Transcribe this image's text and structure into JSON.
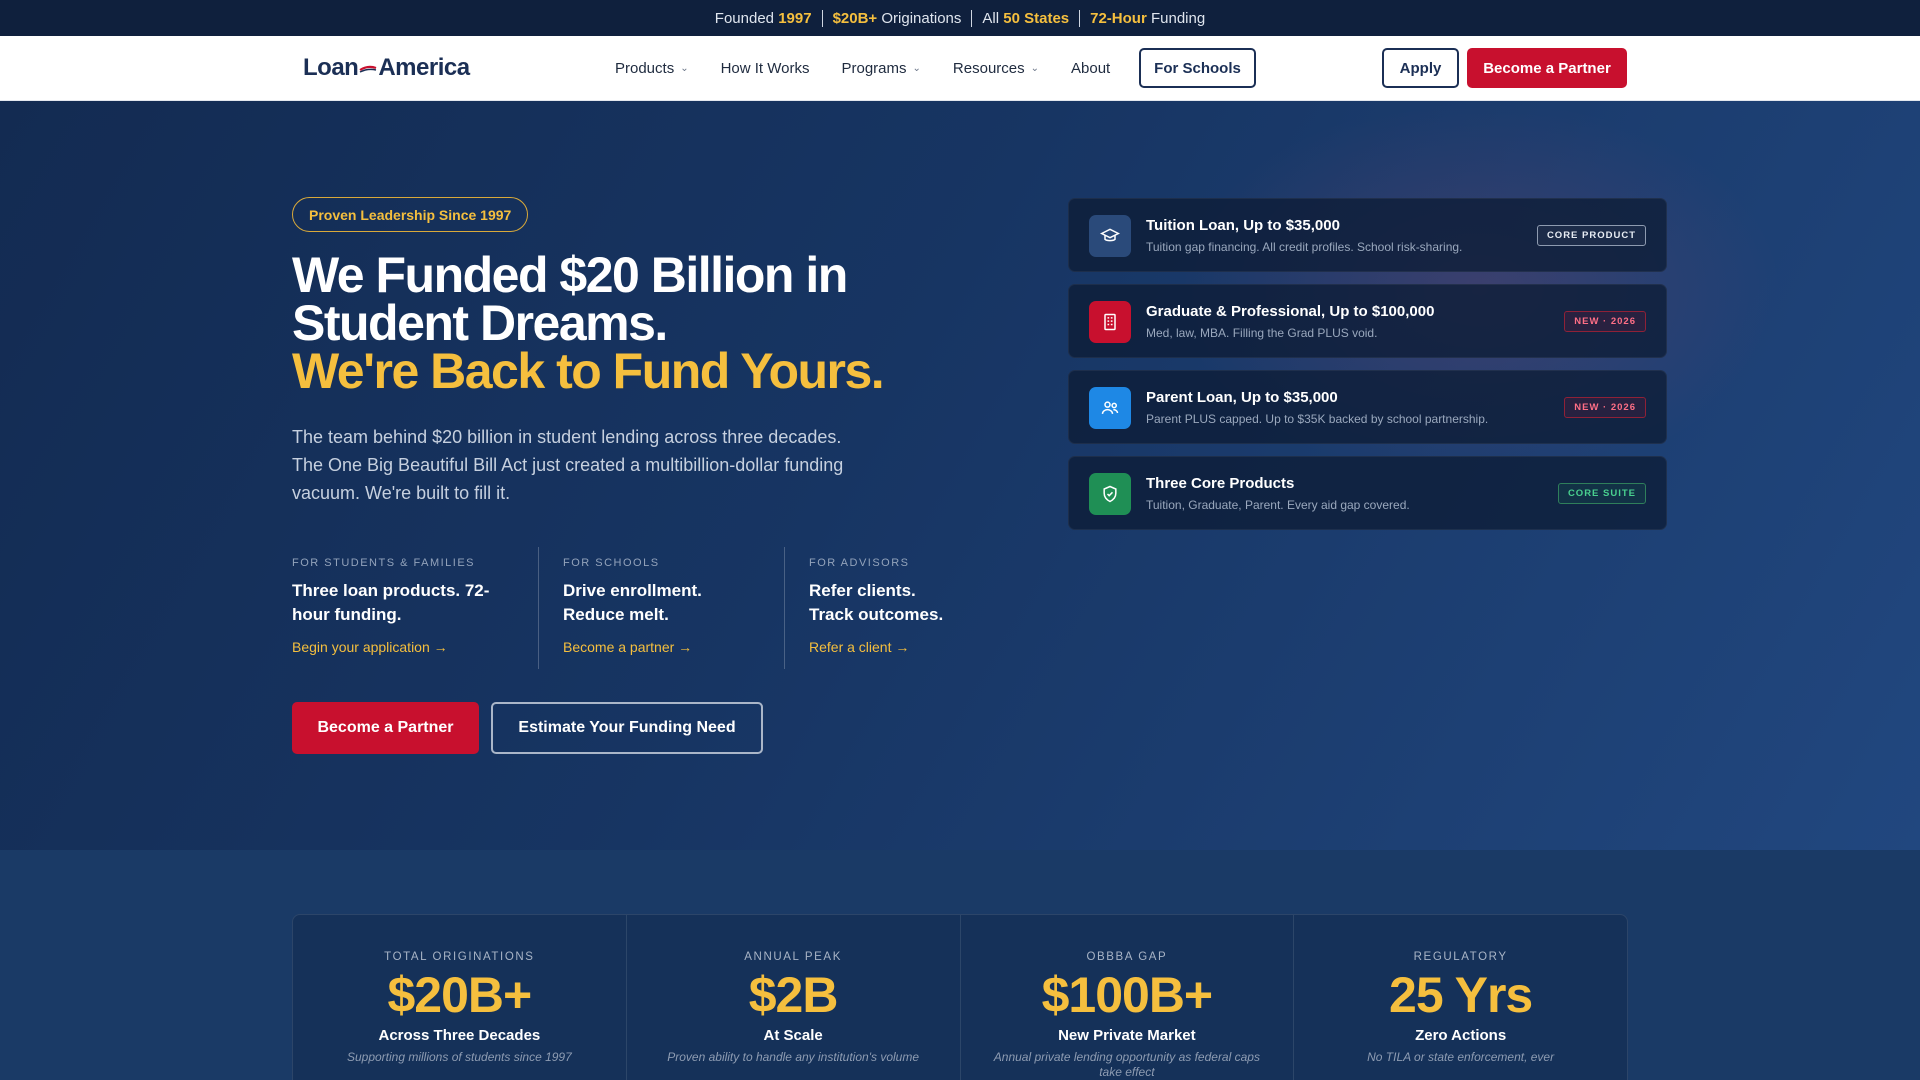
{
  "topbar": {
    "s1_pre": "Founded ",
    "s1_hl": "1997",
    "s2_hl": "$20B+",
    "s2_post": " Originations",
    "s3_pre": "All ",
    "s3_hl": "50 States",
    "s4_hl": "72-Hour",
    "s4_post": " Funding"
  },
  "nav": {
    "logo_a": "Loan",
    "logo_b": "America",
    "links": [
      {
        "label": "Products",
        "dropdown": true
      },
      {
        "label": "How It Works",
        "dropdown": false
      },
      {
        "label": "Programs",
        "dropdown": true
      },
      {
        "label": "Resources",
        "dropdown": true
      },
      {
        "label": "About",
        "dropdown": false
      }
    ],
    "for_schools": "For Schools",
    "apply": "Apply",
    "become_partner": "Become a Partner"
  },
  "hero": {
    "pill": "Proven Leadership Since 1997",
    "title_1": "We Funded $20 Billion in",
    "title_2": "Student Dreams.",
    "title_gold": "We're Back to Fund Yours.",
    "lead": "The team behind $20 billion in student lending across three decades. The One Big Beautiful Bill Act just created a multibillion-dollar funding vacuum. We're built to fill it.",
    "audiences": [
      {
        "tag": "FOR STUDENTS & FAMILIES",
        "title": "Three loan products. 72-hour funding.",
        "link": "Begin your application →"
      },
      {
        "tag": "FOR SCHOOLS",
        "title": "Drive enrollment. Reduce melt.",
        "link": "Become a partner →"
      },
      {
        "tag": "FOR ADVISORS",
        "title": "Refer clients. Track outcomes.",
        "link": "Refer a client →"
      }
    ],
    "cta_primary": "Become a Partner",
    "cta_secondary": "Estimate Your Funding Need"
  },
  "cards": [
    {
      "icon": "graduation-cap-icon",
      "color": "#2a4a7a",
      "title": "Tuition Loan, Up to $35,000",
      "sub": "Tuition gap financing. All credit profiles. School risk-sharing.",
      "badge": "CORE PRODUCT",
      "badge_type": "core"
    },
    {
      "icon": "building-icon",
      "color": "#c8102e",
      "title": "Graduate & Professional, Up to $100,000",
      "sub": "Med, law, MBA. Filling the Grad PLUS void.",
      "badge": "NEW · 2026",
      "badge_type": "new"
    },
    {
      "icon": "users-icon",
      "color": "#1e88e5",
      "title": "Parent Loan, Up to $35,000",
      "sub": "Parent PLUS capped. Up to $35K backed by school partnership.",
      "badge": "NEW · 2026",
      "badge_type": "new"
    },
    {
      "icon": "shield-check-icon",
      "color": "#1f8f55",
      "title": "Three Core Products",
      "sub": "Tuition, Graduate, Parent. Every aid gap covered.",
      "badge": "CORE SUITE",
      "badge_type": "suite"
    }
  ],
  "stats": [
    {
      "label": "TOTAL ORIGINATIONS",
      "value": "$20B+",
      "caption": "Across Three Decades",
      "note": "Supporting millions of students since 1997"
    },
    {
      "label": "ANNUAL PEAK",
      "value": "$2B",
      "caption": "At Scale",
      "note": "Proven ability to handle any institution's volume"
    },
    {
      "label": "OBBBA GAP",
      "value": "$100B+",
      "caption": "New Private Market",
      "note": "Annual private lending opportunity as federal caps take effect"
    },
    {
      "label": "REGULATORY",
      "value": "25 Yrs",
      "caption": "Zero Actions",
      "note": "No TILA or state enforcement, ever"
    }
  ]
}
